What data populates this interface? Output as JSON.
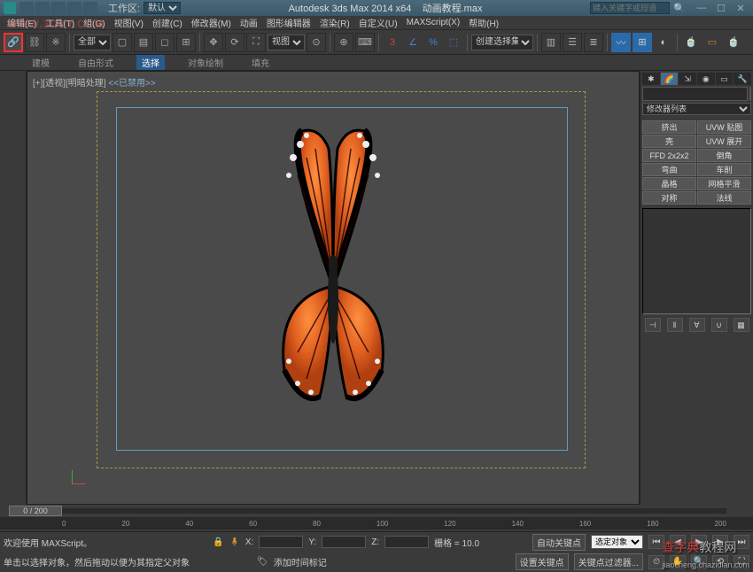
{
  "titlebar": {
    "workspace_label": "工作区:",
    "workspace_value": "默认",
    "app_title": "Autodesk 3ds Max  2014 x64",
    "file_name": "动画教程.max",
    "search_placeholder": "键入关键字或短语"
  },
  "menus": [
    "编辑(E)",
    "工具(T)",
    "组(G)",
    "视图(V)",
    "创建(C)",
    "修改器(M)",
    "动画",
    "图形编辑器",
    "渲染(R)",
    "自定义(U)",
    "MAXScript(X)",
    "帮助(H)"
  ],
  "watermark_url": "WWW.3DXY.COM",
  "main_toolbar": {
    "selset_dropdown": "全部",
    "view_dropdown": "视图",
    "render_dropdown": "创建选择集"
  },
  "sub_toolbar": {
    "items": [
      "建模",
      "自由形式",
      "选择",
      "对象绘制",
      "填充"
    ],
    "active_index": 2
  },
  "viewport": {
    "label_prefix": "[+][透视][明暗处理]",
    "label_suffix": " <<已禁用>>"
  },
  "right_panel": {
    "modifier_list": "修改器列表",
    "buttons": [
      [
        "挤出",
        "UVW 贴图"
      ],
      [
        "壳",
        "UVW 展开"
      ],
      [
        "FFD 2x2x2",
        "倒角"
      ],
      [
        "弯曲",
        "车削"
      ],
      [
        "晶格",
        "网格平滑"
      ],
      [
        "对称",
        "法线"
      ]
    ]
  },
  "timeline": {
    "slider_label": "0 / 200",
    "ticks": [
      "0",
      "20",
      "40",
      "60",
      "80",
      "100",
      "120",
      "140",
      "160",
      "180",
      "200"
    ]
  },
  "statusbar": {
    "welcome": "欢迎使用 MAXScript。",
    "coords": {
      "x_label": "X:",
      "y_label": "Y:",
      "z_label": "Z:",
      "grid_label": "栅格 = 10.0"
    },
    "hint": "单击以选择对象，然后拖动以便为其指定父对象",
    "autokey": "自动关键点",
    "setkey": "设置关键点",
    "sel_dropdown": "选定对象",
    "keyfilter": "关键点过滤器...",
    "add_time_tag": "添加时间标记"
  },
  "watermark_cn": {
    "part1": "查字典",
    "part2": "教程网",
    "url": "jiaocheng.chazidian.com"
  },
  "chart_data": {
    "type": "table",
    "note": "3D viewport screenshot - no chart data"
  }
}
